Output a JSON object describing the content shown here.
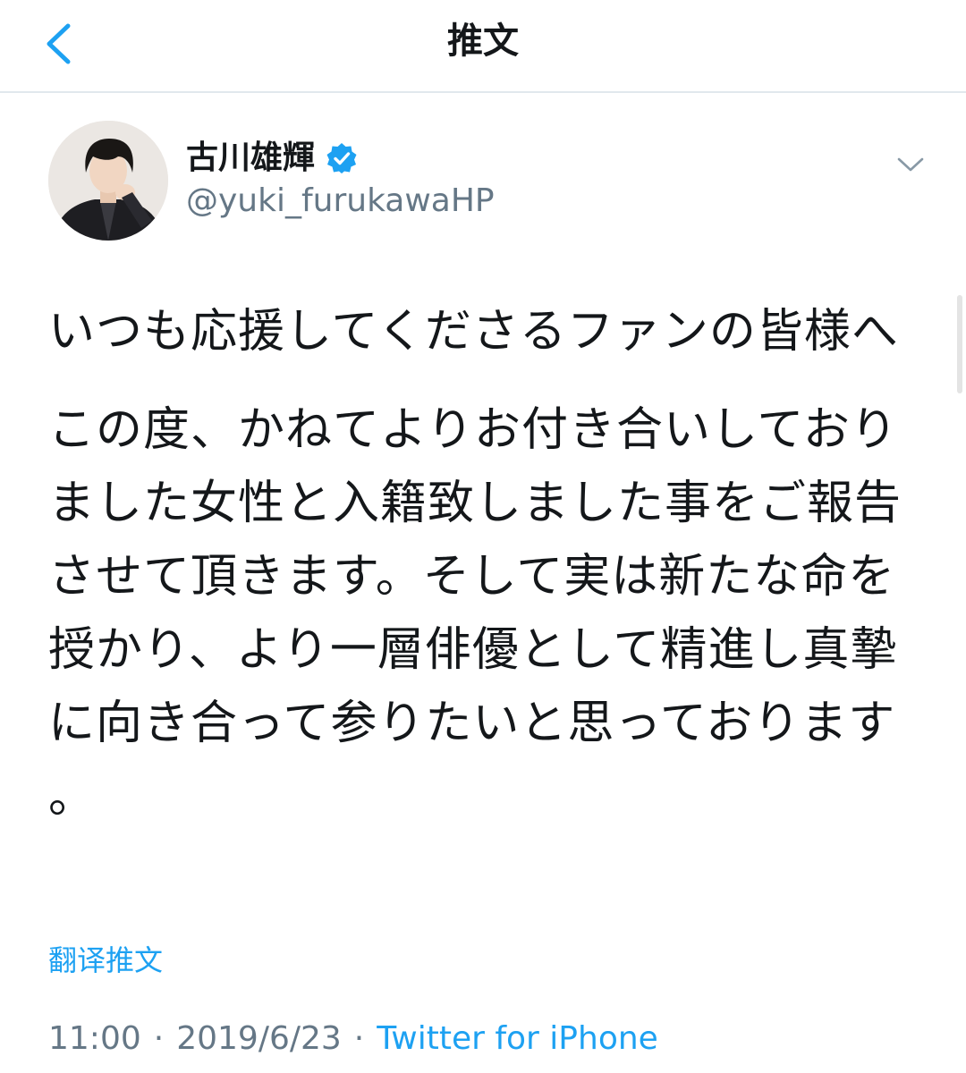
{
  "nav": {
    "title": "推文"
  },
  "author": {
    "display_name": "古川雄輝",
    "handle": "@yuki_furukawaHP",
    "verified": true
  },
  "tweet": {
    "paragraphs": [
      "いつも応援してくださるファンの皆様へ",
      "この度、かねてよりお付き合いしておりました女性と入籍致しました事をご報告させて頂きます。そして実は新たな命を授かり、より一層俳優として精進し真摯に向き合って参りたいと思っております。"
    ],
    "translate_label": "翻译推文",
    "time": "11:00",
    "date": "2019/6/23",
    "separator": "·",
    "source": "Twitter for iPhone"
  },
  "colors": {
    "accent": "#1da1f2",
    "secondary_text": "#657786",
    "primary_text": "#14171a",
    "divider": "#e1e8ed"
  },
  "icons": {
    "back": "chevron-left-icon",
    "verified": "verified-badge-icon",
    "more": "chevron-down-icon"
  }
}
